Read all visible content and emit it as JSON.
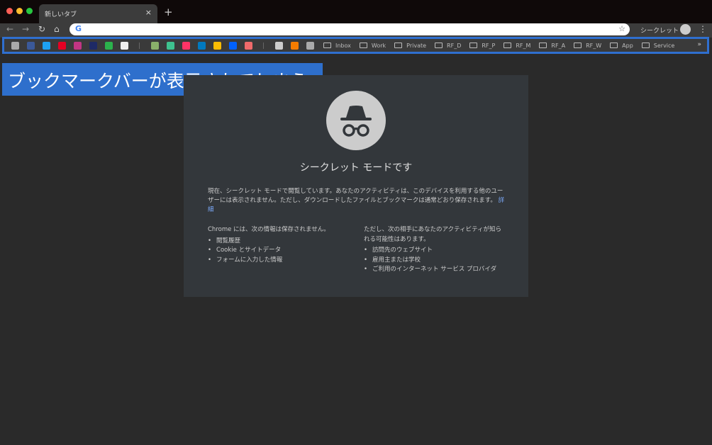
{
  "tab": {
    "title": "新しいタブ",
    "close": "×",
    "new": "+"
  },
  "toolbar": {
    "back": "←",
    "forward": "→",
    "reload": "↻",
    "home": "⌂",
    "google_g": "G",
    "star": "☆",
    "profile_label": "シークレット",
    "menu": "⋮"
  },
  "bookmarks": {
    "icons": [
      {
        "name": "apps",
        "color": "#aaaaaa"
      },
      {
        "name": "facebook",
        "color": "#3b5998"
      },
      {
        "name": "twitter",
        "color": "#1da1f2"
      },
      {
        "name": "pinterest",
        "color": "#e60023"
      },
      {
        "name": "instagram",
        "color": "#c13584"
      },
      {
        "name": "stack",
        "color": "#1e2a66"
      },
      {
        "name": "feedly",
        "color": "#2bb24c"
      },
      {
        "name": "github",
        "color": "#eeeeee"
      },
      {
        "name": "cloud",
        "color": "#8ab06a"
      },
      {
        "name": "b-app",
        "color": "#3ec28f"
      },
      {
        "name": "invision",
        "color": "#ff3366"
      },
      {
        "name": "trello",
        "color": "#0079bf"
      },
      {
        "name": "google-drive",
        "color": "#fbbc04"
      },
      {
        "name": "dropbox",
        "color": "#0061ff"
      },
      {
        "name": "asana",
        "color": "#f06a6a"
      },
      {
        "name": "calendar",
        "color": "#cccccc"
      },
      {
        "name": "analytics",
        "color": "#f57c00"
      },
      {
        "name": "chart",
        "color": "#aaaaaa"
      }
    ],
    "folders": [
      "Inbox",
      "Work",
      "Private",
      "RF_D",
      "RF_P",
      "RF_M",
      "RF_A",
      "RF_W",
      "App",
      "Service"
    ],
    "more": "»"
  },
  "annotation": "ブックマークバーが表示されてしまう",
  "incognito": {
    "title": "シークレット モードです",
    "description": "現在、シークレット モードで閲覧しています。あなたのアクティビティは、このデバイスを利用する他のユーザーには表示されません。ただし、ダウンロードしたファイルとブックマークは通常どおり保存されます。",
    "learn_more": "詳細",
    "left_heading": "Chrome には、次の情報は保存されません。",
    "left_items": [
      "閲覧履歴",
      "Cookie とサイトデータ",
      "フォームに入力した情報"
    ],
    "right_heading": "ただし、次の相手にあなたのアクティビティが知られる可能性はあります。",
    "right_items": [
      "訪問先のウェブサイト",
      "雇用主または学校",
      "ご利用のインターネット サービス プロバイダ"
    ]
  }
}
